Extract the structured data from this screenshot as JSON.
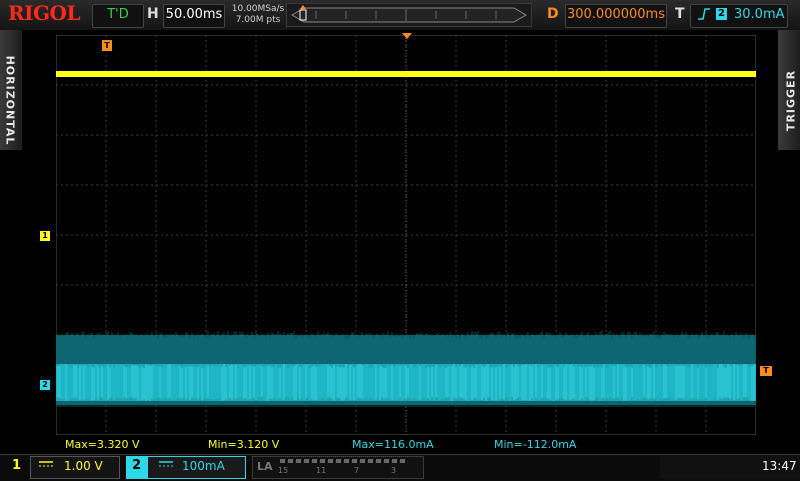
{
  "brand": "RIGOL",
  "top": {
    "run_status": "T'D",
    "horizontal_label": "H",
    "timebase": "50.00ms",
    "sample_rate": "10.00MSa/s",
    "memory_depth": "7.00M pts",
    "delay_label": "D",
    "delay": "300.000000ms",
    "trigger_label": "T",
    "trigger_source": "2",
    "trigger_level": "30.0mA"
  },
  "side": {
    "left_tab": "HORIZONTAL",
    "right_tab": "TRIGGER"
  },
  "markers": {
    "ch1": "1",
    "ch2": "2",
    "trigger": "T",
    "time_position": "T"
  },
  "measurements": [
    "Max=3.320 V",
    "Min=3.120 V",
    "Max=116.0mA",
    "Min=-112.0mA"
  ],
  "bottom": {
    "ch1_number": "1",
    "ch1_scale": "1.00 V",
    "ch2_number": "2",
    "ch2_scale": "100mA",
    "la_label": "LA",
    "la_numbers": [
      "15",
      "11",
      "7",
      "3"
    ],
    "clock": "13:47"
  },
  "colors": {
    "ch1": "#ffff19",
    "ch2": "#2fd8e8",
    "trigger": "#ff8a1e",
    "brand": "#ff2a1a",
    "run": "#37d24a"
  },
  "icons": {
    "coupling": "dc-coupling-icon",
    "trigger_edge": "rising-edge-icon"
  }
}
